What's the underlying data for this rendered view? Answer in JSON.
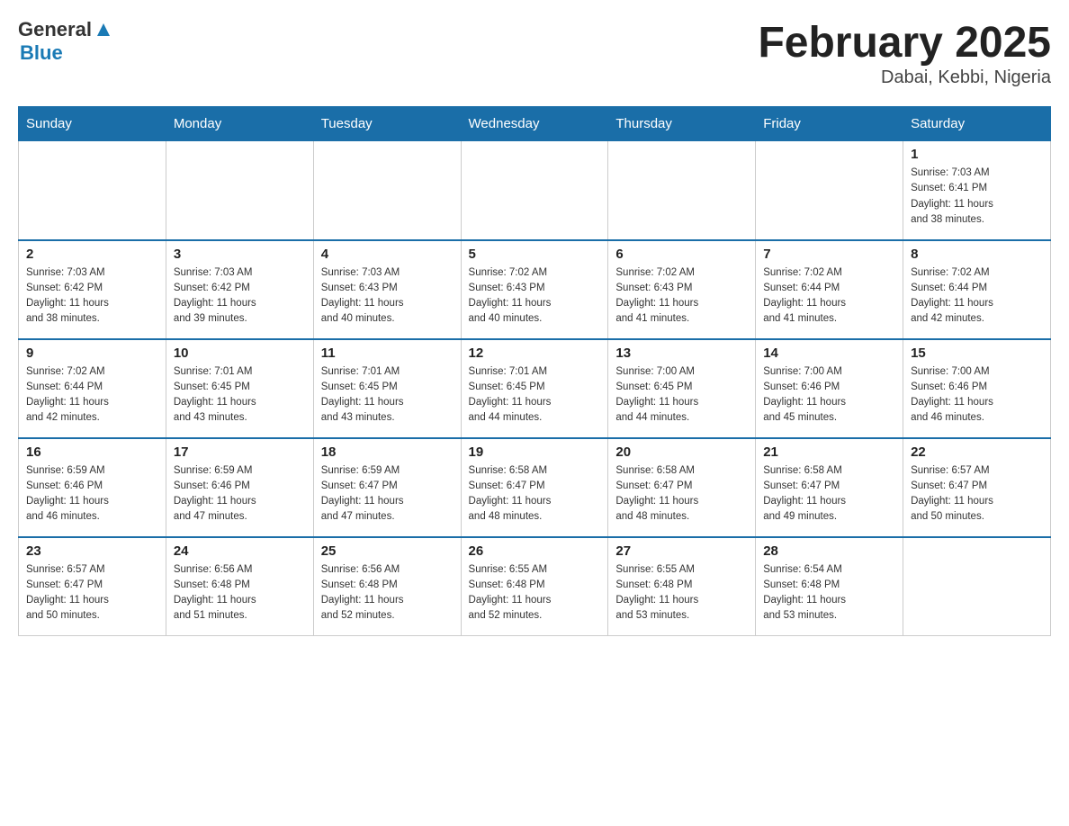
{
  "header": {
    "logo": {
      "general": "General",
      "blue": "Blue"
    },
    "title": "February 2025",
    "location": "Dabai, Kebbi, Nigeria"
  },
  "days_of_week": [
    "Sunday",
    "Monday",
    "Tuesday",
    "Wednesday",
    "Thursday",
    "Friday",
    "Saturday"
  ],
  "weeks": [
    {
      "days": [
        {
          "number": "",
          "info": ""
        },
        {
          "number": "",
          "info": ""
        },
        {
          "number": "",
          "info": ""
        },
        {
          "number": "",
          "info": ""
        },
        {
          "number": "",
          "info": ""
        },
        {
          "number": "",
          "info": ""
        },
        {
          "number": "1",
          "info": "Sunrise: 7:03 AM\nSunset: 6:41 PM\nDaylight: 11 hours\nand 38 minutes."
        }
      ]
    },
    {
      "days": [
        {
          "number": "2",
          "info": "Sunrise: 7:03 AM\nSunset: 6:42 PM\nDaylight: 11 hours\nand 38 minutes."
        },
        {
          "number": "3",
          "info": "Sunrise: 7:03 AM\nSunset: 6:42 PM\nDaylight: 11 hours\nand 39 minutes."
        },
        {
          "number": "4",
          "info": "Sunrise: 7:03 AM\nSunset: 6:43 PM\nDaylight: 11 hours\nand 40 minutes."
        },
        {
          "number": "5",
          "info": "Sunrise: 7:02 AM\nSunset: 6:43 PM\nDaylight: 11 hours\nand 40 minutes."
        },
        {
          "number": "6",
          "info": "Sunrise: 7:02 AM\nSunset: 6:43 PM\nDaylight: 11 hours\nand 41 minutes."
        },
        {
          "number": "7",
          "info": "Sunrise: 7:02 AM\nSunset: 6:44 PM\nDaylight: 11 hours\nand 41 minutes."
        },
        {
          "number": "8",
          "info": "Sunrise: 7:02 AM\nSunset: 6:44 PM\nDaylight: 11 hours\nand 42 minutes."
        }
      ]
    },
    {
      "days": [
        {
          "number": "9",
          "info": "Sunrise: 7:02 AM\nSunset: 6:44 PM\nDaylight: 11 hours\nand 42 minutes."
        },
        {
          "number": "10",
          "info": "Sunrise: 7:01 AM\nSunset: 6:45 PM\nDaylight: 11 hours\nand 43 minutes."
        },
        {
          "number": "11",
          "info": "Sunrise: 7:01 AM\nSunset: 6:45 PM\nDaylight: 11 hours\nand 43 minutes."
        },
        {
          "number": "12",
          "info": "Sunrise: 7:01 AM\nSunset: 6:45 PM\nDaylight: 11 hours\nand 44 minutes."
        },
        {
          "number": "13",
          "info": "Sunrise: 7:00 AM\nSunset: 6:45 PM\nDaylight: 11 hours\nand 44 minutes."
        },
        {
          "number": "14",
          "info": "Sunrise: 7:00 AM\nSunset: 6:46 PM\nDaylight: 11 hours\nand 45 minutes."
        },
        {
          "number": "15",
          "info": "Sunrise: 7:00 AM\nSunset: 6:46 PM\nDaylight: 11 hours\nand 46 minutes."
        }
      ]
    },
    {
      "days": [
        {
          "number": "16",
          "info": "Sunrise: 6:59 AM\nSunset: 6:46 PM\nDaylight: 11 hours\nand 46 minutes."
        },
        {
          "number": "17",
          "info": "Sunrise: 6:59 AM\nSunset: 6:46 PM\nDaylight: 11 hours\nand 47 minutes."
        },
        {
          "number": "18",
          "info": "Sunrise: 6:59 AM\nSunset: 6:47 PM\nDaylight: 11 hours\nand 47 minutes."
        },
        {
          "number": "19",
          "info": "Sunrise: 6:58 AM\nSunset: 6:47 PM\nDaylight: 11 hours\nand 48 minutes."
        },
        {
          "number": "20",
          "info": "Sunrise: 6:58 AM\nSunset: 6:47 PM\nDaylight: 11 hours\nand 48 minutes."
        },
        {
          "number": "21",
          "info": "Sunrise: 6:58 AM\nSunset: 6:47 PM\nDaylight: 11 hours\nand 49 minutes."
        },
        {
          "number": "22",
          "info": "Sunrise: 6:57 AM\nSunset: 6:47 PM\nDaylight: 11 hours\nand 50 minutes."
        }
      ]
    },
    {
      "days": [
        {
          "number": "23",
          "info": "Sunrise: 6:57 AM\nSunset: 6:47 PM\nDaylight: 11 hours\nand 50 minutes."
        },
        {
          "number": "24",
          "info": "Sunrise: 6:56 AM\nSunset: 6:48 PM\nDaylight: 11 hours\nand 51 minutes."
        },
        {
          "number": "25",
          "info": "Sunrise: 6:56 AM\nSunset: 6:48 PM\nDaylight: 11 hours\nand 52 minutes."
        },
        {
          "number": "26",
          "info": "Sunrise: 6:55 AM\nSunset: 6:48 PM\nDaylight: 11 hours\nand 52 minutes."
        },
        {
          "number": "27",
          "info": "Sunrise: 6:55 AM\nSunset: 6:48 PM\nDaylight: 11 hours\nand 53 minutes."
        },
        {
          "number": "28",
          "info": "Sunrise: 6:54 AM\nSunset: 6:48 PM\nDaylight: 11 hours\nand 53 minutes."
        },
        {
          "number": "",
          "info": ""
        }
      ]
    }
  ]
}
